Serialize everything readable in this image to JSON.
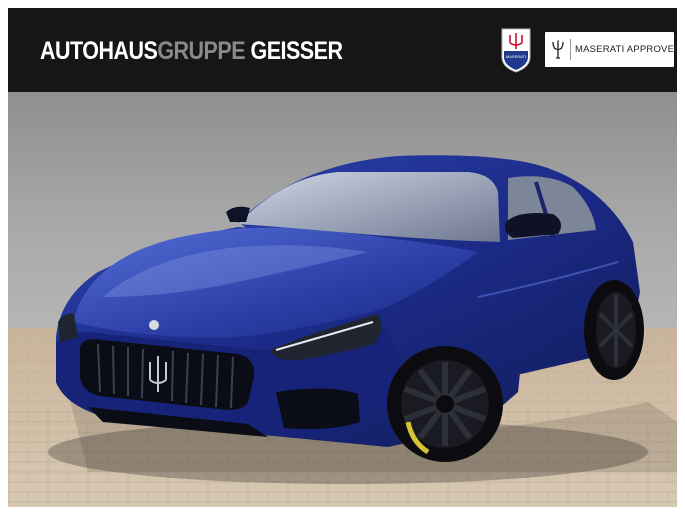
{
  "header": {
    "brand": {
      "part1": "AUTOHAUS",
      "part2": "GRUPPE",
      "part3": " GEISSER"
    },
    "emblem_text": "MASERATI",
    "approved_label": "MASERATI APPROVED",
    "icons": [
      "maserati-emblem-icon",
      "trident-icon"
    ]
  },
  "photo": {
    "subject": "car-photo",
    "colors": {
      "car_body": "#1e2f8c",
      "car_highlight": "#4a63d0",
      "wall": "#9a9a9a",
      "pavement": "#cdbca3",
      "header_bg": "#161616"
    }
  }
}
